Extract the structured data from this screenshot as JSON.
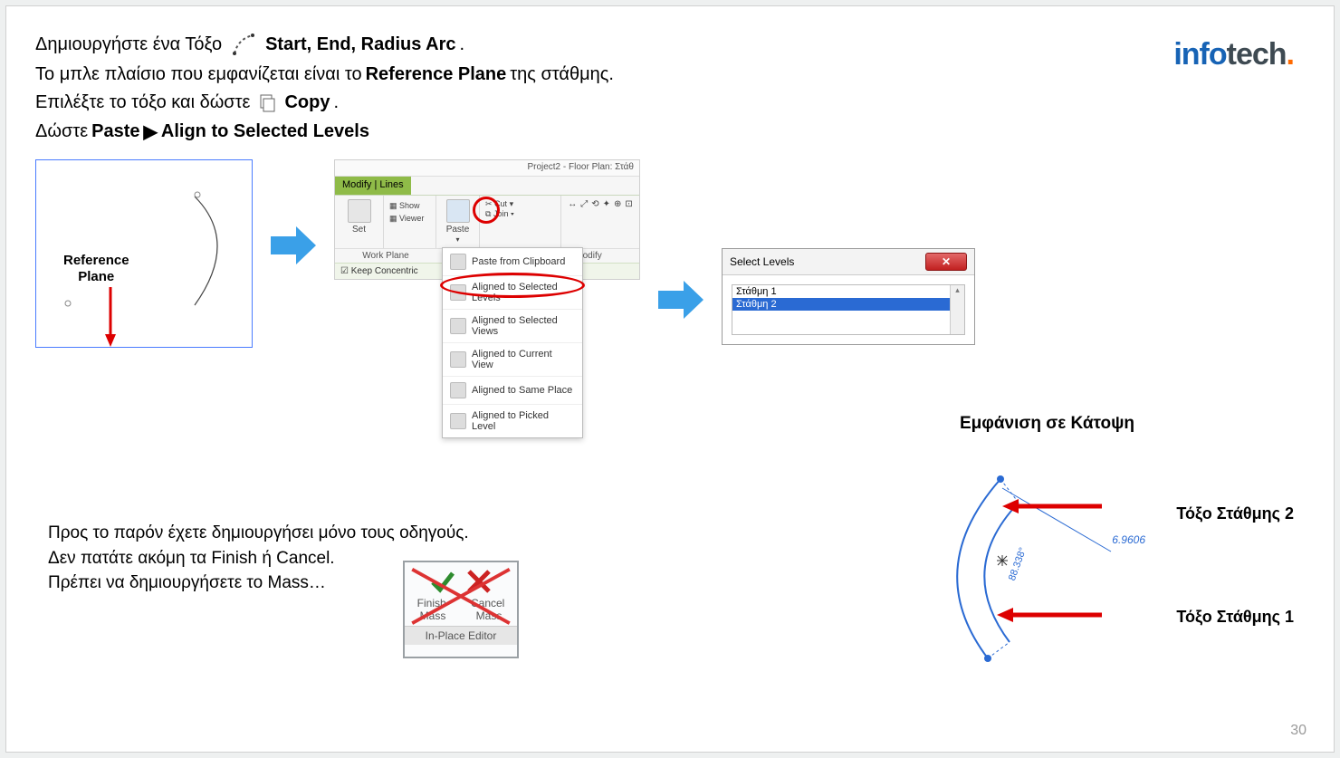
{
  "logo": {
    "part1": "info",
    "part2": "tech",
    "dot": "."
  },
  "lines": {
    "l1a": "Δημιουργήστε ένα Τόξο",
    "l1b": "Start, End, Radius Arc",
    "l1c": ".",
    "l2a": "Το μπλε πλαίσιο που εμφανίζεται είναι το ",
    "l2b": "Reference Plane",
    "l2c": " της στάθμης.",
    "l3a": "Επιλέξτε το τόξο και δώστε",
    "l3b": "Copy",
    "l3c": ".",
    "l4a": "Δώστε ",
    "l4b": "Paste",
    "l4c": "▶",
    "l4d": "Align to Selected Levels"
  },
  "refplane_label": "Reference\nPlane",
  "ribbon": {
    "title": "Project2 - Floor Plan: Στάθ",
    "tab": "Modify | Lines",
    "set": "Set",
    "show": "Show",
    "viewer": "Viewer",
    "paste": "Paste",
    "cut": "Cut",
    "join": "Join",
    "workplane": "Work Plane",
    "modify": "Modify",
    "keep": "Keep Concentric",
    "menu": {
      "m1": "Paste from Clipboard",
      "m2": "Aligned to Selected Levels",
      "m3": "Aligned to Selected Views",
      "m4": "Aligned to Current View",
      "m5": "Aligned to Same Place",
      "m6": "Aligned to Picked Level"
    }
  },
  "dialog": {
    "title": "Select Levels",
    "item1": "Στάθμη 1",
    "item2": "Στάθμη 2"
  },
  "para": {
    "p1": "Προς το παρόν έχετε δημιουργήσει μόνο τους οδηγούς.",
    "p2": "Δεν πατάτε ακόμη τα Finish ή Cancel.",
    "p3": "Πρέπει να δημιουργήσετε το Mass…"
  },
  "finish": {
    "finish1": "Finish",
    "finish2": "Mass",
    "cancel1": "Cancel",
    "cancel2": "Mass",
    "editor": "In-Place Editor"
  },
  "plan": {
    "title": "Εμφάνιση σε Κάτοψη",
    "lbl1": "Τόξο Στάθμης 2",
    "lbl2": "Τόξο Στάθμης 1",
    "dim_len": "6.9606",
    "dim_ang": "88.338°"
  },
  "page_number": "30"
}
